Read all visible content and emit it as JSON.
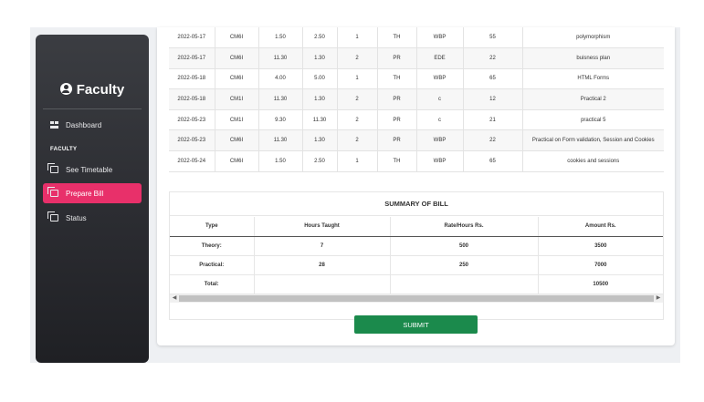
{
  "sidebar": {
    "brand": "Faculty",
    "section_label": "FACULTY",
    "items": [
      {
        "label": "Dashboard",
        "icon": "dashboard-icon"
      },
      {
        "label": "See Timetable",
        "icon": "copy-icon"
      },
      {
        "label": "Prepare Bill",
        "icon": "copy-icon",
        "active": true
      },
      {
        "label": "Status",
        "icon": "copy-icon"
      }
    ]
  },
  "entries": [
    [
      "2022-05-17",
      "CM6I",
      "1.50",
      "2.50",
      "1",
      "TH",
      "WBP",
      "55",
      "polymorphism"
    ],
    [
      "2022-05-17",
      "CM6I",
      "11.30",
      "1.30",
      "2",
      "PR",
      "EDE",
      "22",
      "buisness plan"
    ],
    [
      "2022-05-18",
      "CM6I",
      "4.00",
      "5.00",
      "1",
      "TH",
      "WBP",
      "65",
      "HTML Forms"
    ],
    [
      "2022-05-18",
      "CM1I",
      "11.30",
      "1.30",
      "2",
      "PR",
      "c",
      "12",
      "Practical 2"
    ],
    [
      "2022-05-23",
      "CM1I",
      "9.30",
      "11.30",
      "2",
      "PR",
      "c",
      "21",
      "practical 5"
    ],
    [
      "2022-05-23",
      "CM6I",
      "11.30",
      "1.30",
      "2",
      "PR",
      "WBP",
      "22",
      "Practical on Form validation, Session and Cookies"
    ],
    [
      "2022-05-24",
      "CM6I",
      "1.50",
      "2.50",
      "1",
      "TH",
      "WBP",
      "65",
      "cookies and sessions"
    ]
  ],
  "summary": {
    "title": "SUMMARY OF BILL",
    "headers": [
      "Type",
      "Hours Taught",
      "Rate/Hours Rs.",
      "Amount Rs."
    ],
    "rows": [
      [
        "Theory:",
        "7",
        "500",
        "3500"
      ],
      [
        "Practical:",
        "28",
        "250",
        "7000"
      ],
      [
        "Total:",
        "",
        "",
        "10500"
      ]
    ]
  },
  "submit_label": "SUBMIT",
  "colors": {
    "accent": "#e8306a",
    "submit": "#1b8a4c",
    "sidebar": "#2f3035"
  }
}
